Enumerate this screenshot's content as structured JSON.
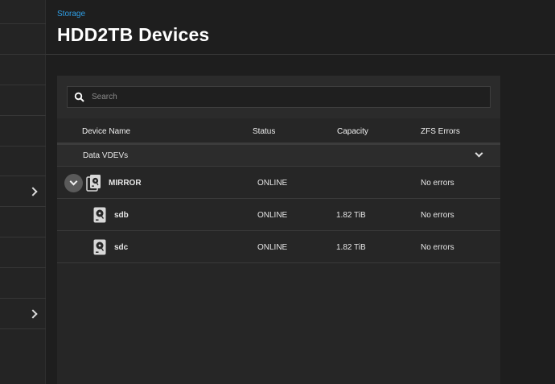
{
  "sidebar": {
    "items": [
      {
        "has_chevron": false
      },
      {
        "has_chevron": false
      },
      {
        "has_chevron": false
      },
      {
        "has_chevron": false
      },
      {
        "has_chevron": false
      },
      {
        "has_chevron": true,
        "icon": "chevron-right-icon"
      },
      {
        "has_chevron": false
      },
      {
        "has_chevron": false
      },
      {
        "has_chevron": false
      },
      {
        "has_chevron": true,
        "icon": "chevron-right-icon"
      }
    ]
  },
  "header": {
    "breadcrumb": "Storage",
    "title": "HDD2TB Devices"
  },
  "search": {
    "placeholder": "Search",
    "value": "",
    "icon": "search-icon"
  },
  "table": {
    "columns": {
      "device_name": "Device Name",
      "status": "Status",
      "capacity": "Capacity",
      "zfs_errors": "ZFS Errors"
    },
    "group": {
      "label": "Data VDEVs",
      "icon": "chevron-down-icon"
    },
    "rows": [
      {
        "name": "MIRROR",
        "status": "ONLINE",
        "capacity": "",
        "errors": "No errors",
        "icon": "mirror-disks-icon",
        "expandable": true
      },
      {
        "name": "sdb",
        "status": "ONLINE",
        "capacity": "1.82 TiB",
        "errors": "No errors",
        "icon": "hard-disk-icon",
        "expandable": false
      },
      {
        "name": "sdc",
        "status": "ONLINE",
        "capacity": "1.82 TiB",
        "errors": "No errors",
        "icon": "hard-disk-icon",
        "expandable": false
      }
    ]
  },
  "colors": {
    "accent": "#2f9fe6",
    "background": "#1e1e1e",
    "card": "#262626"
  }
}
